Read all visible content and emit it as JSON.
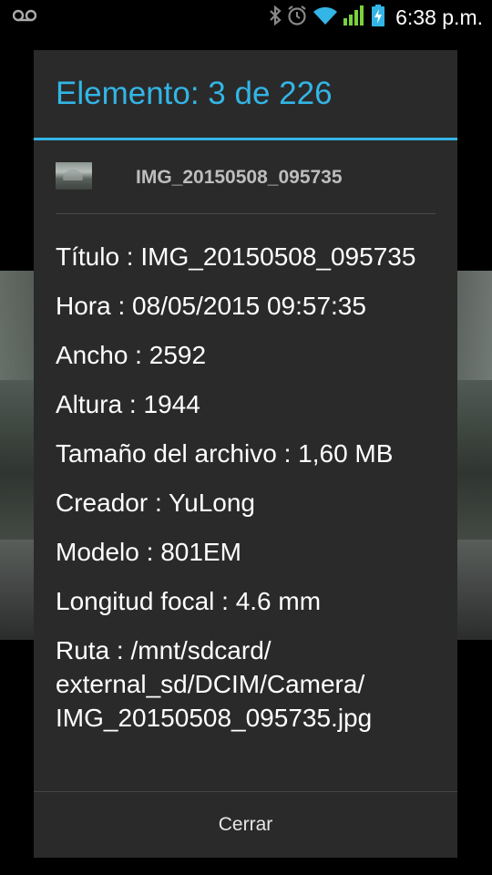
{
  "status_bar": {
    "time": "6:38 p.m.",
    "icons": [
      "voicemail-icon",
      "bluetooth-icon",
      "alarm-icon",
      "wifi-icon",
      "signal-icon",
      "battery-charging-icon"
    ]
  },
  "dialog": {
    "title": "Elemento: 3 de 226",
    "file_name": "IMG_20150508_095735",
    "details": [
      {
        "label": "Título",
        "value": "IMG_20150508_095735"
      },
      {
        "label": "Hora",
        "value": "08/05/2015 09:57:35"
      },
      {
        "label": "Ancho",
        "value": "2592"
      },
      {
        "label": "Altura",
        "value": "1944"
      },
      {
        "label": "Tamaño del archivo",
        "value": "1,60 MB"
      },
      {
        "label": "Creador",
        "value": "YuLong"
      },
      {
        "label": "Modelo",
        "value": "801EM"
      },
      {
        "label": "Longitud focal",
        "value": "4.6 mm"
      },
      {
        "label": "Ruta",
        "value": "/mnt/sdcard/ external_sd/DCIM/Camera/ IMG_20150508_095735.jpg"
      }
    ],
    "separator": " : ",
    "close_label": "Cerrar"
  },
  "colors": {
    "accent": "#33b5e5",
    "dialog_bg": "#2a2a2a",
    "text": "#ffffff"
  }
}
